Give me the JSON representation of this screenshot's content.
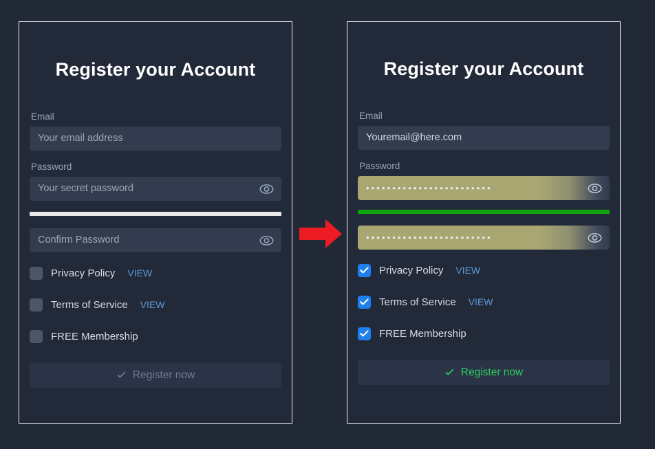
{
  "theme": {
    "page_background": "#212836",
    "panel_background": "#222938",
    "panel_border": "#f2f2f2",
    "field_background": "#323c4e",
    "autofill_background": "#a8a772",
    "checkbox_unchecked": "#4c5668",
    "checkbox_checked": "#1f7feb",
    "link_blue": "#5e9ad8",
    "success_green": "#2fcc60",
    "meter_strong_green": "#0fa40f",
    "meter_blank_white": "#e9e9e9",
    "arrow_red": "#ed1c24",
    "disabled_text": "#707d90"
  },
  "panels": [
    {
      "state": "empty",
      "title": "Register your Account",
      "email": {
        "label": "Email",
        "value": "",
        "placeholder": "Your email address"
      },
      "password": {
        "label": "Password",
        "value": "",
        "placeholder": "Your secret password",
        "reveal_icon": "eye-icon"
      },
      "strength_meter": {
        "state": "blank",
        "color": "#e9e9e9",
        "fill_percent": 100
      },
      "confirm_password": {
        "label": "",
        "value": "",
        "placeholder": "Confirm Password",
        "reveal_icon": "eye-icon"
      },
      "checkboxes": [
        {
          "label": "Privacy Policy",
          "checked": false,
          "link": "VIEW"
        },
        {
          "label": "Terms of Service",
          "checked": false,
          "link": "VIEW"
        },
        {
          "label": "FREE Membership",
          "checked": false,
          "link": ""
        }
      ],
      "submit": {
        "label": "Register now",
        "icon": "check-icon",
        "enabled": false
      }
    },
    {
      "state": "filled",
      "title": "Register your Account",
      "email": {
        "label": "Email",
        "value": "Youremail@here.com",
        "placeholder": "Your email address"
      },
      "password": {
        "label": "Password",
        "value": "••••••••••••••••••••••••",
        "placeholder": "Your secret password",
        "masked_char_count": 24,
        "reveal_icon": "eye-icon"
      },
      "strength_meter": {
        "state": "strong",
        "color": "#0fa40f",
        "fill_percent": 100
      },
      "confirm_password": {
        "label": "",
        "value": "••••••••••••••••••••••••",
        "placeholder": "Confirm Password",
        "masked_char_count": 24,
        "reveal_icon": "eye-icon"
      },
      "checkboxes": [
        {
          "label": "Privacy Policy",
          "checked": true,
          "link": "VIEW"
        },
        {
          "label": "Terms of Service",
          "checked": true,
          "link": "VIEW"
        },
        {
          "label": "FREE Membership",
          "checked": true,
          "link": ""
        }
      ],
      "submit": {
        "label": "Register now",
        "icon": "check-icon",
        "enabled": true
      }
    }
  ],
  "annotation": {
    "arrow": {
      "icon": "arrow-right-icon",
      "color": "#ed1c24",
      "direction": "right"
    }
  }
}
